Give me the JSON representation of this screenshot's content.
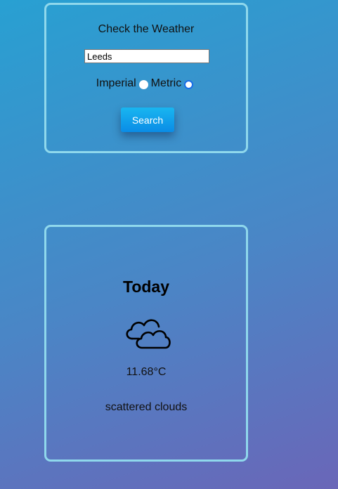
{
  "search": {
    "title": "Check the Weather",
    "city_value": "Leeds",
    "units": {
      "imperial_label": "Imperial",
      "metric_label": "Metric",
      "selected": "Metric"
    },
    "button_label": "Search"
  },
  "weather": {
    "day": "Today",
    "icon": "scattered-clouds-icon",
    "temperature": "11.68°C",
    "description": "scattered clouds"
  },
  "colors": {
    "card_border": "#8fd8ec",
    "button": "#0a8ce6",
    "radio_checked": "#1a6ee8"
  }
}
